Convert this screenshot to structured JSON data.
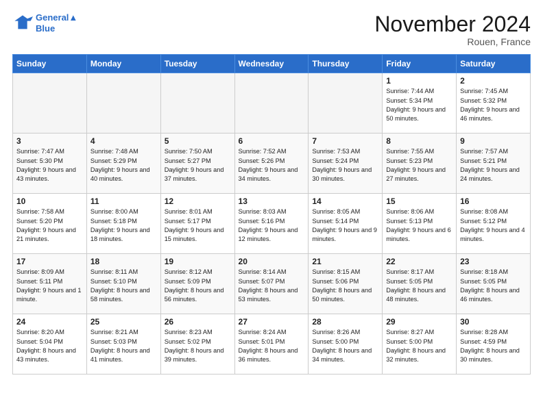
{
  "header": {
    "logo_line1": "General",
    "logo_line2": "Blue",
    "month": "November 2024",
    "location": "Rouen, France"
  },
  "weekdays": [
    "Sunday",
    "Monday",
    "Tuesday",
    "Wednesday",
    "Thursday",
    "Friday",
    "Saturday"
  ],
  "weeks": [
    [
      {
        "day": "",
        "info": ""
      },
      {
        "day": "",
        "info": ""
      },
      {
        "day": "",
        "info": ""
      },
      {
        "day": "",
        "info": ""
      },
      {
        "day": "",
        "info": ""
      },
      {
        "day": "1",
        "info": "Sunrise: 7:44 AM\nSunset: 5:34 PM\nDaylight: 9 hours and 50 minutes."
      },
      {
        "day": "2",
        "info": "Sunrise: 7:45 AM\nSunset: 5:32 PM\nDaylight: 9 hours and 46 minutes."
      }
    ],
    [
      {
        "day": "3",
        "info": "Sunrise: 7:47 AM\nSunset: 5:30 PM\nDaylight: 9 hours and 43 minutes."
      },
      {
        "day": "4",
        "info": "Sunrise: 7:48 AM\nSunset: 5:29 PM\nDaylight: 9 hours and 40 minutes."
      },
      {
        "day": "5",
        "info": "Sunrise: 7:50 AM\nSunset: 5:27 PM\nDaylight: 9 hours and 37 minutes."
      },
      {
        "day": "6",
        "info": "Sunrise: 7:52 AM\nSunset: 5:26 PM\nDaylight: 9 hours and 34 minutes."
      },
      {
        "day": "7",
        "info": "Sunrise: 7:53 AM\nSunset: 5:24 PM\nDaylight: 9 hours and 30 minutes."
      },
      {
        "day": "8",
        "info": "Sunrise: 7:55 AM\nSunset: 5:23 PM\nDaylight: 9 hours and 27 minutes."
      },
      {
        "day": "9",
        "info": "Sunrise: 7:57 AM\nSunset: 5:21 PM\nDaylight: 9 hours and 24 minutes."
      }
    ],
    [
      {
        "day": "10",
        "info": "Sunrise: 7:58 AM\nSunset: 5:20 PM\nDaylight: 9 hours and 21 minutes."
      },
      {
        "day": "11",
        "info": "Sunrise: 8:00 AM\nSunset: 5:18 PM\nDaylight: 9 hours and 18 minutes."
      },
      {
        "day": "12",
        "info": "Sunrise: 8:01 AM\nSunset: 5:17 PM\nDaylight: 9 hours and 15 minutes."
      },
      {
        "day": "13",
        "info": "Sunrise: 8:03 AM\nSunset: 5:16 PM\nDaylight: 9 hours and 12 minutes."
      },
      {
        "day": "14",
        "info": "Sunrise: 8:05 AM\nSunset: 5:14 PM\nDaylight: 9 hours and 9 minutes."
      },
      {
        "day": "15",
        "info": "Sunrise: 8:06 AM\nSunset: 5:13 PM\nDaylight: 9 hours and 6 minutes."
      },
      {
        "day": "16",
        "info": "Sunrise: 8:08 AM\nSunset: 5:12 PM\nDaylight: 9 hours and 4 minutes."
      }
    ],
    [
      {
        "day": "17",
        "info": "Sunrise: 8:09 AM\nSunset: 5:11 PM\nDaylight: 9 hours and 1 minute."
      },
      {
        "day": "18",
        "info": "Sunrise: 8:11 AM\nSunset: 5:10 PM\nDaylight: 8 hours and 58 minutes."
      },
      {
        "day": "19",
        "info": "Sunrise: 8:12 AM\nSunset: 5:09 PM\nDaylight: 8 hours and 56 minutes."
      },
      {
        "day": "20",
        "info": "Sunrise: 8:14 AM\nSunset: 5:07 PM\nDaylight: 8 hours and 53 minutes."
      },
      {
        "day": "21",
        "info": "Sunrise: 8:15 AM\nSunset: 5:06 PM\nDaylight: 8 hours and 50 minutes."
      },
      {
        "day": "22",
        "info": "Sunrise: 8:17 AM\nSunset: 5:05 PM\nDaylight: 8 hours and 48 minutes."
      },
      {
        "day": "23",
        "info": "Sunrise: 8:18 AM\nSunset: 5:05 PM\nDaylight: 8 hours and 46 minutes."
      }
    ],
    [
      {
        "day": "24",
        "info": "Sunrise: 8:20 AM\nSunset: 5:04 PM\nDaylight: 8 hours and 43 minutes."
      },
      {
        "day": "25",
        "info": "Sunrise: 8:21 AM\nSunset: 5:03 PM\nDaylight: 8 hours and 41 minutes."
      },
      {
        "day": "26",
        "info": "Sunrise: 8:23 AM\nSunset: 5:02 PM\nDaylight: 8 hours and 39 minutes."
      },
      {
        "day": "27",
        "info": "Sunrise: 8:24 AM\nSunset: 5:01 PM\nDaylight: 8 hours and 36 minutes."
      },
      {
        "day": "28",
        "info": "Sunrise: 8:26 AM\nSunset: 5:00 PM\nDaylight: 8 hours and 34 minutes."
      },
      {
        "day": "29",
        "info": "Sunrise: 8:27 AM\nSunset: 5:00 PM\nDaylight: 8 hours and 32 minutes."
      },
      {
        "day": "30",
        "info": "Sunrise: 8:28 AM\nSunset: 4:59 PM\nDaylight: 8 hours and 30 minutes."
      }
    ]
  ]
}
